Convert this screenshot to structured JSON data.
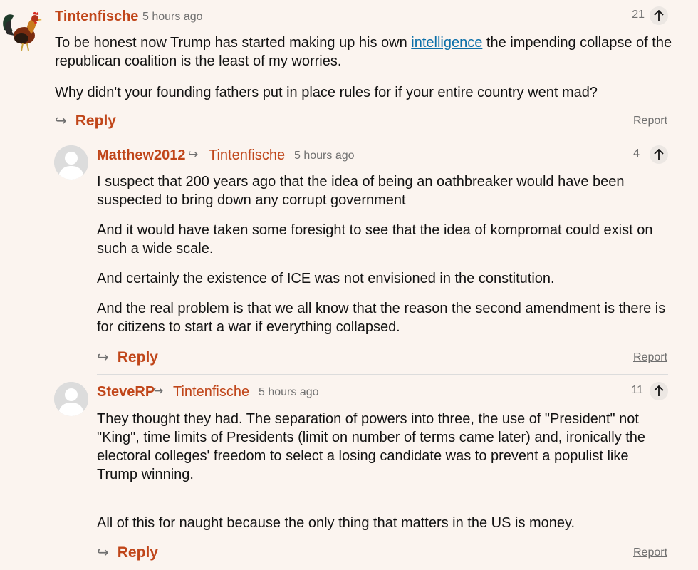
{
  "comments": [
    {
      "username": "Tintenfische",
      "time": "5 hours ago",
      "votes": "21",
      "avatar": "rooster-avatar",
      "body_pre": "To be honest now Trump has started making up his own ",
      "body_link": "intelligence",
      "body_post": " the impending collapse of the republican coalition is the least of my worries.",
      "body_p2": "Why didn't your founding fathers put in place rules for if your entire country went mad?",
      "reply_label": "Reply",
      "report_label": "Report"
    },
    {
      "username": "Matthew2012",
      "reply_to": "Tintenfische",
      "time": "5 hours ago",
      "votes": "4",
      "avatar": "default-avatar",
      "paragraphs": [
        "I suspect that 200 years ago that the idea of being an oathbreaker would have been suspected to bring down any corrupt government",
        "And it would have taken some foresight to see that the idea of kompromat could exist on such a wide scale.",
        "And certainly the existence of ICE was not envisioned in the constitution.",
        "And the real problem is that we all know that the reason the second amendment is there is for citizens to start a war if everything collapsed."
      ],
      "reply_label": "Reply",
      "report_label": "Report"
    },
    {
      "username": "SteveRP",
      "reply_to": "Tintenfische",
      "time": "5 hours ago",
      "votes": "11",
      "avatar": "default-avatar",
      "paragraphs": [
        "They thought they had. The separation of powers into three, the use of \"President\" not \"King\", time limits of Presidents (limit on number of terms came later) and, ironically the electoral colleges' freedom to select a losing candidate was to prevent a populist like Trump winning.",
        "All of this for naught because the only thing that matters in the US is money."
      ],
      "reply_label": "Reply",
      "report_label": "Report"
    }
  ],
  "colors": {
    "username": "#c0461a",
    "link": "#0b6fa8",
    "background": "#fbf4ef"
  }
}
